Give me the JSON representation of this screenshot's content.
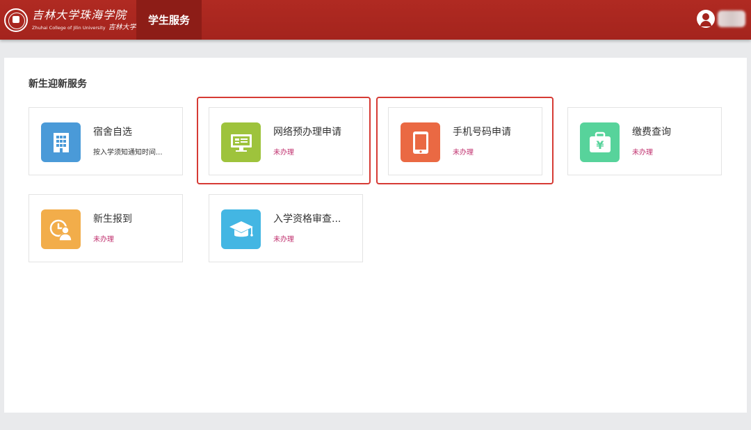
{
  "header": {
    "logo_cn": "吉林大学珠海学院",
    "logo_en": "Zhuhai College of Jilin University",
    "logo_signature": "吉林大学",
    "nav_tab": "学生服务"
  },
  "main": {
    "section_title": "新生迎新服务",
    "cards": [
      {
        "title": "宿舍自选",
        "status": "按入学须知通知时间...",
        "icon": "building-icon",
        "color": "#4a9ad8"
      },
      {
        "title": "网络预办理申请",
        "status": "未办理",
        "icon": "monitor-icon",
        "color": "#9ec33c"
      },
      {
        "title": "手机号码申请",
        "status": "未办理",
        "icon": "phone-icon",
        "color": "#ea6943"
      },
      {
        "title": "缴费查询",
        "status": "未办理",
        "icon": "yen-wallet-icon",
        "color": "#57d39b"
      },
      {
        "title": "新生报到",
        "status": "未办理",
        "icon": "clock-user-icon",
        "color": "#f2ad4a"
      },
      {
        "title": "入学资格审查...",
        "status": "未办理",
        "icon": "graduation-cap-icon",
        "color": "#43b6e3"
      }
    ]
  },
  "colors": {
    "header_red": "#a4241d",
    "highlight_red": "#d63a34",
    "status_pink": "#c0306e"
  }
}
